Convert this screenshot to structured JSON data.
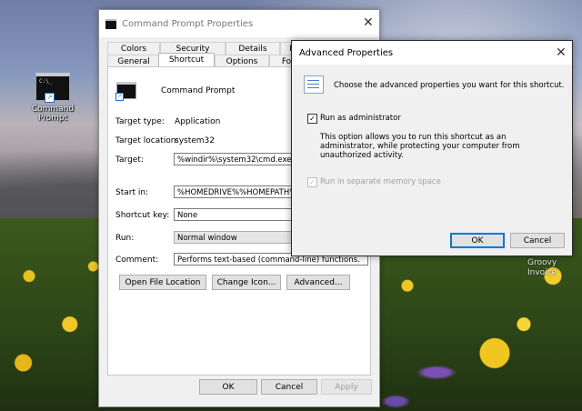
{
  "desktop": {
    "icon_label": [
      "Command",
      "Prompt"
    ],
    "icon_glyph": "C:\\_",
    "watermark": [
      "Groovy",
      "Invoice"
    ]
  },
  "properties_dialog": {
    "title": "Command Prompt Properties",
    "tabs_back": [
      "Colors",
      "Security",
      "Details",
      "P"
    ],
    "tabs_front": [
      "General",
      "Shortcut",
      "Options",
      "Fo"
    ],
    "active_tab": "Shortcut",
    "shortcut_name": "Command Prompt",
    "target_type_label": "Target type:",
    "target_type_value": "Application",
    "target_location_label": "Target location:",
    "target_location_value": "system32",
    "target_label": "Target:",
    "target_value": "%windir%\\system32\\cmd.exe",
    "start_in_label": "Start in:",
    "start_in_value": "%HOMEDRIVE%%HOMEPATH%",
    "shortcut_key_label": "Shortcut key:",
    "shortcut_key_value": "None",
    "run_label": "Run:",
    "run_value": "Normal window",
    "comment_label": "Comment:",
    "comment_value": "Performs text-based (command-line) functions.",
    "buttons": {
      "open_file_location": "Open File Location",
      "change_icon": "Change Icon...",
      "advanced": "Advanced...",
      "ok": "OK",
      "cancel": "Cancel",
      "apply": "Apply"
    }
  },
  "advanced_dialog": {
    "title": "Advanced Properties",
    "heading": "Choose the advanced properties you want for this shortcut.",
    "run_as_admin_label": "Run as administrator",
    "run_as_admin_checked": true,
    "run_as_admin_desc": [
      "This option allows you to run this shortcut as an",
      "administrator, while protecting your computer from",
      "unauthorized activity."
    ],
    "separate_memory_label": "Run in separate memory space",
    "separate_memory_checked": true,
    "separate_memory_disabled": true,
    "ok_label": "OK",
    "cancel_label": "Cancel"
  },
  "glyphs": {
    "close": "✕",
    "check": "✓",
    "arrow": "↗"
  },
  "colors": {
    "accent": "#0078d7"
  }
}
